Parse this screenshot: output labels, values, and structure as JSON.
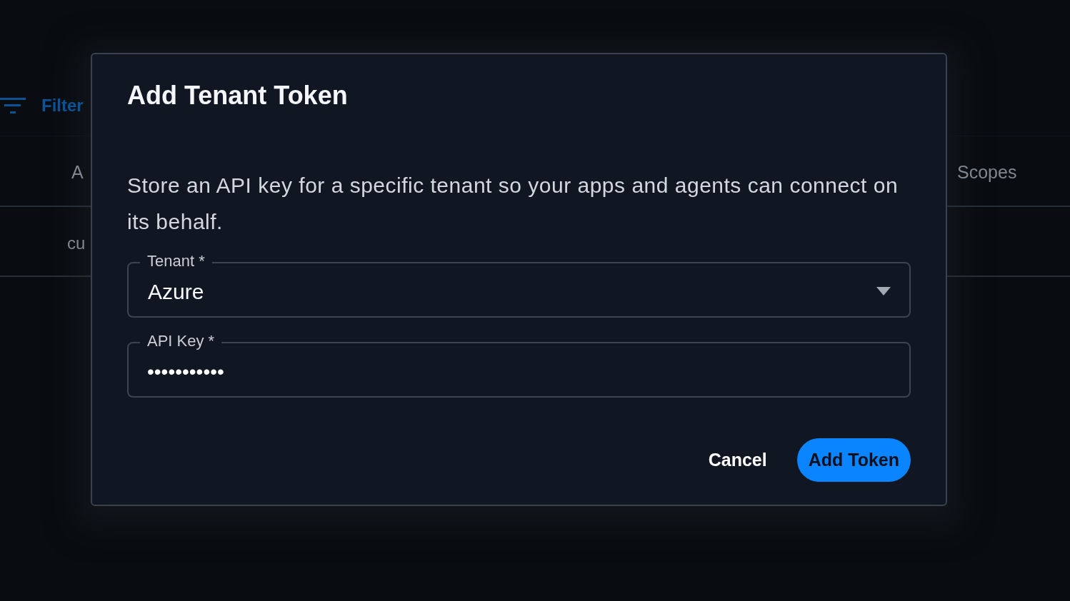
{
  "background": {
    "filter_button": {
      "label": "Filter"
    },
    "table": {
      "columns": [
        {
          "label": "A"
        },
        {
          "label": "Scopes"
        }
      ],
      "rows": [
        {
          "cells": [
            "cu"
          ]
        }
      ]
    }
  },
  "dialog": {
    "title": "Add Tenant Token",
    "description": "Store an API key for a specific tenant so your apps and agents can connect on its behalf.",
    "fields": [
      {
        "kind": "select",
        "label": "Tenant *",
        "value": "Azure"
      },
      {
        "kind": "password",
        "label": "API Key *",
        "value": "•••••••••••"
      }
    ],
    "buttons": [
      {
        "kind": "text",
        "label": "Cancel"
      },
      {
        "kind": "primary",
        "label": "Add Token"
      }
    ]
  }
}
